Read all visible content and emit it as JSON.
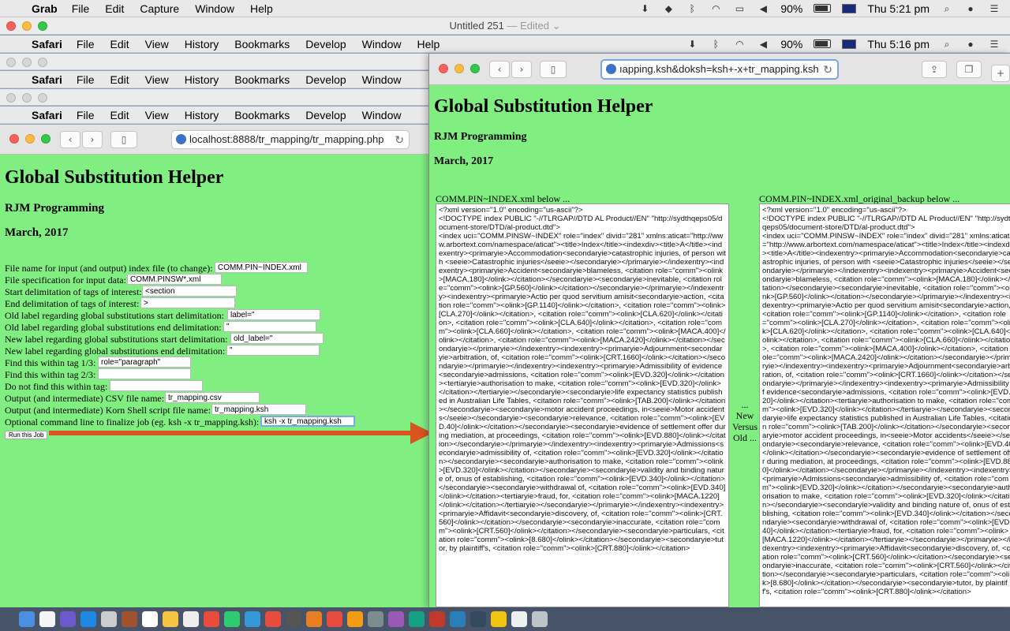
{
  "menubar": {
    "app": "Grab",
    "items": [
      "File",
      "Edit",
      "Capture",
      "Window",
      "Help"
    ],
    "battery": "90%",
    "clock": "Thu 5:21 pm"
  },
  "untitled_window": {
    "title": "Untitled 251",
    "edited": "— Edited ⌄"
  },
  "safari_menu": {
    "app": "Safari",
    "items": [
      "File",
      "Edit",
      "View",
      "History",
      "Bookmarks",
      "Develop",
      "Window",
      "Help"
    ],
    "battery": "90%",
    "clock": "Thu 5:16 pm"
  },
  "safari_menu_2": {
    "app": "Safari",
    "items": [
      "File",
      "Edit",
      "View",
      "History",
      "Bookmarks",
      "Develop",
      "Window"
    ]
  },
  "safari_menu_3": {
    "app": "Safari",
    "items": [
      "File",
      "Edit",
      "View",
      "History",
      "Bookmarks",
      "Develop",
      "Window"
    ]
  },
  "left_window": {
    "url": "localhost:8888/tr_mapping/tr_mapping.php",
    "title": "Global Substitution Helper",
    "author": "RJM Programming",
    "date": "March, 2017",
    "form": [
      {
        "label": "File name for input (and output) index file (to change):",
        "value": "COMM.PIN~INDEX.xml"
      },
      {
        "label": "File specification for input data:",
        "value": "COMM.PINSW*.xml"
      },
      {
        "label": "Start delimitation of tags of interest:",
        "value": "<section"
      },
      {
        "label": "End delimitation of tags of interest:",
        "value": ">"
      },
      {
        "label": "Old label regarding global substitutions start delimitation:",
        "value": "label=\""
      },
      {
        "label": "Old label regarding global substitutions end delimitation:",
        "value": "\""
      },
      {
        "label": "New label regarding global substitutions start delimitation:",
        "value": "old_label=\""
      },
      {
        "label": "New label regarding global substitutions end delimitation:",
        "value": "\""
      },
      {
        "label": "Find this within tag 1/3:",
        "value": "role=\"paragraph\""
      },
      {
        "label": "Find this within tag 2/3:",
        "value": ""
      },
      {
        "label": "Do not find this within tag:",
        "value": ""
      },
      {
        "label": "Output (and intermediate) CSV file name:",
        "value": "tr_mapping.csv"
      },
      {
        "label": "Output (and intermediate) Korn Shell script file name:",
        "value": "tr_mapping.ksh"
      },
      {
        "label": "Optional command line to finalize job (eg. ksh -x tr_mapping.ksh):",
        "value": "ksh -x tr_mapping.ksh"
      }
    ],
    "run_button": "Run this Job"
  },
  "right_window": {
    "url": "ıapping.ksh&doksh=ksh+-x+tr_mapping.ksh",
    "title": "Global Substitution Helper",
    "author": "RJM Programming",
    "date": "March, 2017",
    "new_caption": "COMM.PIN~INDEX.xml below ...",
    "old_caption": "COMM.PIN~INDEX.xml_original_backup below ...",
    "versus": "... New Versus Old ...",
    "new_xml": "<?xml version=\"1.0\" encoding=\"us-ascii\"?>\n<!DOCTYPE index PUBLIC \"-//TLRGAP//DTD AL Product//EN\" \"http://sydthqeps05/document-store/DTD/al-product.dtd\">\n<index uci=\"COMM.PINSW~INDEX\" role=\"index\" divid=\"281\" xmlns:aticat=\"http://www.arbortext.com/namespace/aticat\"><title>Index</title><indexdiv><title>A</title><indexentry><primaryie>Accommodation<secondaryie>catastrophic injuries, of person with <seeie>Catastrophic injuries</seeie></secondaryie></primaryie></indexentry><indexentry><primaryie>Accident<secondaryie>blameless, <citation role=\"comm\"><olink>[MACA.180]</olink></citation></secondaryie><secondaryie>inevitable, <citation role=\"comm\"><olink>[GP.560]</olink></citation></secondaryie></primaryie></indexentry><indexentry><primaryie>Actio per quod servitium amisit<secondaryie>action, <citation role=\"comm\"><olink>[GP.1140]</olink></citation>, <citation role=\"comm\"><olink>[CLA.270]</olink></citation>, <citation role=\"comm\"><olink>[CLA.620]</olink></citation>, <citation role=\"comm\"><olink>[CLA.640]</olink></citation>, <citation role=\"comm\"><olink>[CLA.660]</olink></citation>, <citation role=\"comm\"><olink>[MACA.400]</olink></citation>, <citation role=\"comm\"><olink>[MACA.2420]</olink></citation></secondaryie></primaryie></indexentry><indexentry><primaryie>Adjournment<secondaryie>arbitration, of, <citation role=\"comm\"><olink>[CRT.1660]</olink></citation></secondaryie></primaryie></indexentry><indexentry><primaryie>Admissibility of evidence<secondaryie>admissions, <citation role=\"comm\"><olink>[EVD.320]</olink></citation><tertiaryie>authorisation to make, <citation role=\"comm\"><olink>[EVD.320]</olink></citation></tertiaryie></secondaryie><secondaryie>life expectancy statistics published in Australian Life Tables, <citation role=\"comm\"><olink>[TAB.200]</olink></citation></secondaryie><secondaryie>motor accident proceedings, in<seeie>Motor accidents</seeie></secondaryie><secondaryie>relevance, <citation role=\"comm\"><olink>[EVD.40]</olink></citation></secondaryie><secondaryie>evidence of settlement offer during mediation, at proceedings, <citation role=\"comm\"><olink>[EVD.880]</olink></citation></secondaryie></primaryie></indexentry><indexentry><primaryie>Admissions<secondaryie>admissibility of, <citation role=\"comm\"><olink>[EVD.320]</olink></citation></secondaryie><secondaryie>authorisation to make, <citation role=\"comm\"><olink>[EVD.320]</olink></citation></secondaryie><secondaryie>validity and binding nature of, onus of establishing, <citation role=\"comm\"><olink>[EVD.340]</olink></citation></secondaryie><secondaryie>withdrawal of, <citation role=\"comm\"><olink>[EVD.340]</olink></citation><tertiaryie>fraud, for, <citation role=\"comm\"><olink>[MACA.1220]</olink></citation></tertiaryie></secondaryie></primaryie></indexentry><indexentry><primaryie>Affidavit<secondaryie>discovery, of, <citation role=\"comm\"><olink>[CRT.560]</olink></citation></secondaryie><secondaryie>inaccurate, <citation role=\"comm\"><olink>[CRT.560]</olink></citation></secondaryie><secondaryie>particulars, <citation role=\"comm\"><olink>[8.680]</olink></citation></secondaryie><secondaryie>tutor, by plaintiff's, <citation role=\"comm\"><olink>[CRT.880]</olink></citation>",
    "old_xml": "<?xml version=\"1.0\" encoding=\"us-ascii\"?>\n<!DOCTYPE index PUBLIC \"-//TLRGAP//DTD AL Product//EN\" \"http://sydthqeps05/document-store/DTD/al-product.dtd\">\n<index uci=\"COMM.PINSW~INDEX\" role=\"index\" divid=\"281\" xmlns:aticat=\"http://www.arbortext.com/namespace/aticat\"><title>Index</title><indexdiv><title>A</title><indexentry><primaryie>Accommodation<secondaryie>catastrophic injuries, of person with <seeie>Catastrophic injuries</seeie></secondaryie></primaryie></indexentry><indexentry><primaryie>Accident<secondaryie>blameless, <citation role=\"comm\"><olink>[MACA.180]</olink></citation></secondaryie><secondaryie>inevitable, <citation role=\"comm\"><olink>[GP.560]</olink></citation></secondaryie></primaryie></indexentry><indexentry><primaryie>Actio per quod servitium amisit<secondaryie>action, <citation role=\"comm\"><olink>[GP.1140]</olink></citation>, <citation role=\"comm\"><olink>[CLA.270]</olink></citation>, <citation role=\"comm\"><olink>[CLA.620]</olink></citation>, <citation role=\"comm\"><olink>[CLA.640]</olink></citation>, <citation role=\"comm\"><olink>[CLA.660]</olink></citation>, <citation role=\"comm\"><olink>[MACA.400]</olink></citation>, <citation role=\"comm\"><olink>[MACA.2420]</olink></citation></secondaryie></primaryie></indexentry><indexentry><primaryie>Adjournment<secondaryie>arbitration, of, <citation role=\"comm\"><olink>[CRT.1660]</olink></citation></secondaryie></primaryie></indexentry><indexentry><primaryie>Admissibility of evidence<secondaryie>admissions, <citation role=\"comm\"><olink>[EVD.320]</olink></citation><tertiaryie>authorisation to make, <citation role=\"comm\"><olink>[EVD.320]</olink></citation></tertiaryie></secondaryie><secondaryie>life expectancy statistics published in Australian Life Tables, <citation role=\"comm\"><olink>[TAB.200]</olink></citation></secondaryie><secondaryie>motor accident proceedings, in<seeie>Motor accidents</seeie></secondaryie><secondaryie>relevance, <citation role=\"comm\"><olink>[EVD.40]</olink></citation></secondaryie><secondaryie>evidence of settlement offer during mediation, at proceedings, <citation role=\"comm\"><olink>[EVD.880]</olink></citation></secondaryie></primaryie></indexentry><indexentry><primaryie>Admissions<secondaryie>admissibility of, <citation role=\"comm\"><olink>[EVD.320]</olink></citation></secondaryie><secondaryie>authorisation to make, <citation role=\"comm\"><olink>[EVD.320]</olink></citation></secondaryie><secondaryie>validity and binding nature of, onus of establishing, <citation role=\"comm\"><olink>[EVD.340]</olink></citation></secondaryie><secondaryie>withdrawal of, <citation role=\"comm\"><olink>[EVD.340]</olink></citation><tertiaryie>fraud, for, <citation role=\"comm\"><olink>[MACA.1220]</olink></citation></tertiaryie></secondaryie></primaryie></indexentry><indexentry><primaryie>Affidavit<secondaryie>discovery, of, <citation role=\"comm\"><olink>[CRT.560]</olink></citation></secondaryie><secondaryie>inaccurate, <citation role=\"comm\"><olink>[CRT.560]</olink></citation></secondaryie><secondaryie>particulars, <citation role=\"comm\"><olink>[8.680]</olink></citation></secondaryie><secondaryie>tutor, by plaintiff's, <citation role=\"comm\"><olink>[CRT.880]</olink></citation>"
  },
  "colors": {
    "page_bg": "#80ee80",
    "arrow": "#d9541f"
  },
  "icons": [
    "apple-icon",
    "wifi-icon",
    "bluetooth-icon",
    "volume-icon",
    "battery-icon",
    "spotlight-icon",
    "siri-icon",
    "notification-center-icon",
    "back-icon",
    "forward-icon",
    "sidebar-icon",
    "reload-icon",
    "share-icon",
    "tabs-icon",
    "new-tab-icon"
  ]
}
